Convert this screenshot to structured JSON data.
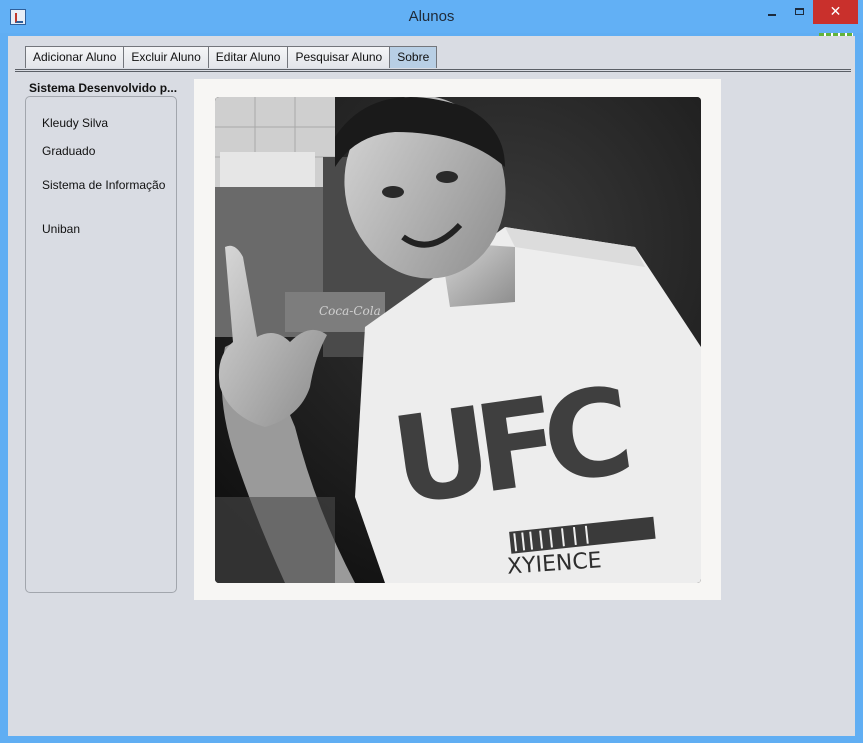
{
  "window": {
    "title": "Alunos",
    "close_glyph": "✕"
  },
  "tabs": [
    {
      "label": "Adicionar Aluno",
      "active": false
    },
    {
      "label": "Excluir Aluno",
      "active": false
    },
    {
      "label": "Editar Aluno",
      "active": false
    },
    {
      "label": "Pesquisar Aluno",
      "active": false
    },
    {
      "label": "Sobre",
      "active": true
    }
  ],
  "about": {
    "panel_title": "Sistema Desenvolvido p...",
    "name": "Kleudy Silva",
    "level": "Graduado",
    "course": "Sistema de Informação",
    "institution": "Uniban"
  },
  "photo": {
    "shirt_text": "UFC",
    "shirt_subtext": "XYIENCE",
    "background_sign": "Coca-Cola"
  }
}
